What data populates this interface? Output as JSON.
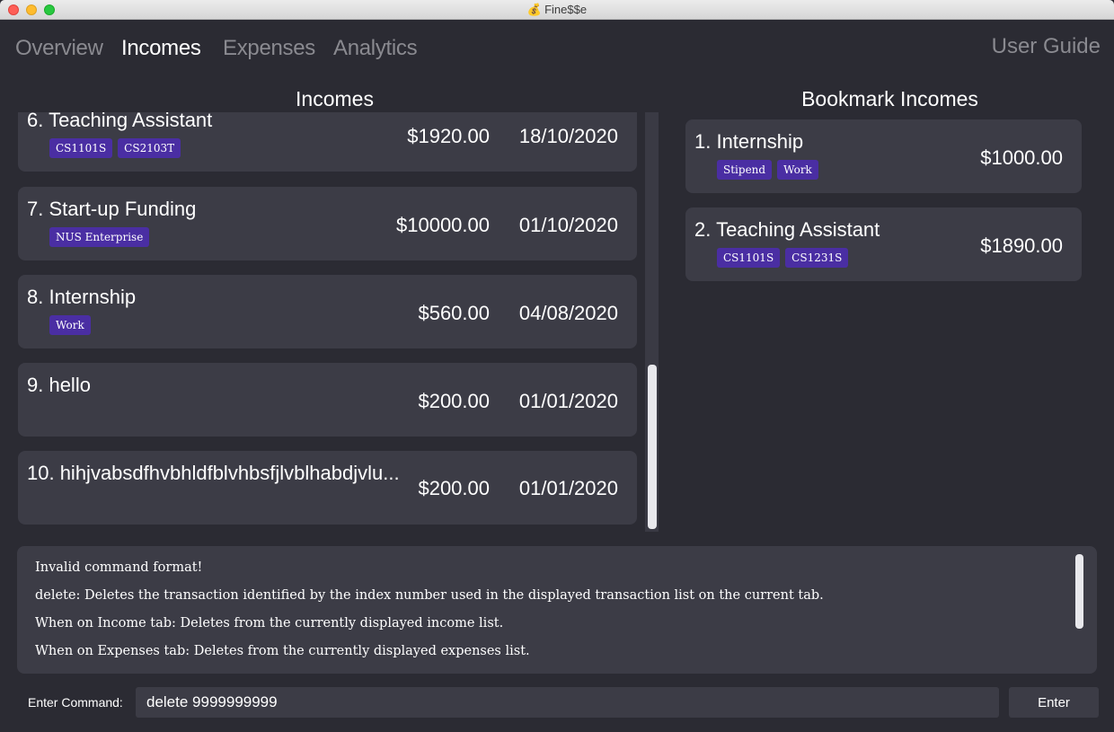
{
  "window": {
    "title": "Fine$$e",
    "title_icon": "💰"
  },
  "tabs": [
    {
      "label": "Overview",
      "active": false
    },
    {
      "label": "Incomes",
      "active": true
    },
    {
      "label": "Expenses",
      "active": false
    },
    {
      "label": "Analytics",
      "active": false
    }
  ],
  "user_guide_label": "User Guide",
  "incomes_panel": {
    "heading": "Incomes",
    "items": [
      {
        "title": "6. Teaching Assistant",
        "tags": [
          "CS1101S",
          "CS2103T"
        ],
        "amount": "$1920.00",
        "date": "18/10/2020"
      },
      {
        "title": "7. Start-up Funding",
        "tags": [
          "NUS Enterprise"
        ],
        "amount": "$10000.00",
        "date": "01/10/2020"
      },
      {
        "title": "8. Internship",
        "tags": [
          "Work"
        ],
        "amount": "$560.00",
        "date": "04/08/2020"
      },
      {
        "title": "9. hello",
        "tags": [],
        "amount": "$200.00",
        "date": "01/01/2020"
      },
      {
        "title": "10. hihjvabsdfhvbhldfblvhbsfjlvblhabdjvlu...",
        "tags": [],
        "amount": "$200.00",
        "date": "01/01/2020"
      }
    ]
  },
  "bookmark_panel": {
    "heading": "Bookmark Incomes",
    "items": [
      {
        "title": "1. Internship",
        "tags": [
          "Stipend",
          "Work"
        ],
        "amount": "$1000.00"
      },
      {
        "title": "2. Teaching Assistant",
        "tags": [
          "CS1101S",
          "CS1231S"
        ],
        "amount": "$1890.00"
      }
    ]
  },
  "result_display": {
    "lines": [
      "Invalid command format!",
      "delete: Deletes the transaction identified by the index number used in the displayed transaction list on the current tab.",
      "When on Income tab: Deletes from the currently displayed income list.",
      "When on Expenses tab: Deletes from the currently displayed expenses list."
    ]
  },
  "command": {
    "label": "Enter Command:",
    "value": "delete 9999999999",
    "enter_label": "Enter"
  },
  "colors": {
    "background": "#2b2b33",
    "card": "#3c3c46",
    "tag": "#4a2ea3",
    "inactive_tab": "#8a8a90"
  }
}
